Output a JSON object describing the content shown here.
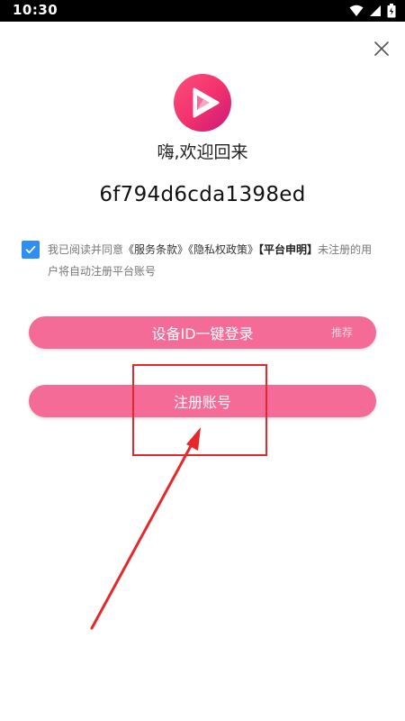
{
  "status_bar": {
    "time": "10:30"
  },
  "header": {
    "close_icon": "close-icon",
    "logo_icon": "video-play-logo"
  },
  "welcome": {
    "title": "嗨,欢迎回来",
    "device_id": "6f794d6cda1398ed"
  },
  "agreement": {
    "checked": true,
    "prefix": "我已阅读并同意",
    "terms_link": "《服务条款》",
    "privacy_link": "《隐私权政策》",
    "platform_link": "【平台申明】",
    "suffix": "未注册的用户将自动注册平台账号"
  },
  "buttons": {
    "device_login": "设备ID一键登录",
    "recommend_tag": "推荐",
    "register": "注册账号"
  },
  "colors": {
    "primary_pink": "#f56b98",
    "checkbox_blue": "#2f8ef4",
    "annotation_red": "#e6282a"
  }
}
